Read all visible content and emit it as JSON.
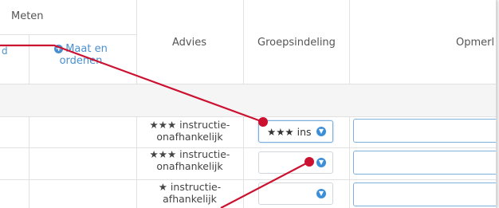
{
  "header": {
    "meten": "Meten",
    "left_edge": "d",
    "maat_link": "Maat en ordenen",
    "advies": "Advies",
    "groepsindeling": "Groepsindeling",
    "opmerking": "Opmerl"
  },
  "rows": [
    {
      "advies_line1": "★★★ instructie-",
      "advies_line2": "onafhankelijk",
      "groep_value": "★★★ ins",
      "remark_value": ""
    },
    {
      "advies_line1": "★★★ instructie-",
      "advies_line2": "onafhankelijk",
      "groep_value": "",
      "remark_value": ""
    },
    {
      "advies_line1": "★ instructie-",
      "advies_line2": "afhankelijk",
      "groep_value": "",
      "remark_value": ""
    }
  ],
  "icons": {
    "plus": "plus-circle-icon",
    "chevron": "chevron-down-icon"
  },
  "colors": {
    "link": "#4a90d0",
    "annotation": "#cc1130",
    "select_chevron": "#3b8fd9",
    "band": "#f5f5f5"
  }
}
